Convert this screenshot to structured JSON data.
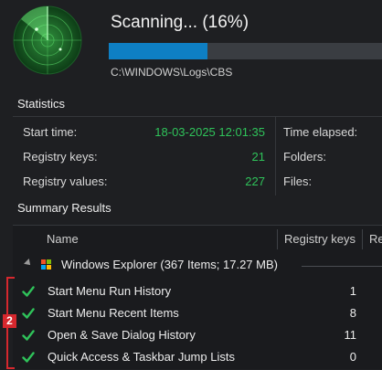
{
  "scan": {
    "title": "Scanning... (16%)",
    "progress": 0.36,
    "current_path": "C:\\WINDOWS\\Logs\\CBS"
  },
  "statistics": {
    "heading": "Statistics",
    "start_time_label": "Start time:",
    "start_time_value": "18-03-2025 12:01:35",
    "registry_keys_label": "Registry keys:",
    "registry_keys_value": "21",
    "registry_values_label": "Registry values:",
    "registry_values_value": "227",
    "time_elapsed_label": "Time elapsed:",
    "folders_label": "Folders:",
    "files_label": "Files:"
  },
  "summary": {
    "heading": "Summary Results",
    "columns": [
      "Name",
      "Registry keys",
      "Re"
    ],
    "group": {
      "label": "Windows Explorer (367 Items; 17.27 MB)",
      "icon": "windows-logo-icon"
    },
    "rows": [
      {
        "name": "Start Menu Run History",
        "registry_keys": "1"
      },
      {
        "name": "Start Menu Recent Items",
        "registry_keys": "8"
      },
      {
        "name": "Open & Save Dialog History",
        "registry_keys": "11"
      },
      {
        "name": "Quick Access & Taskbar Jump Lists",
        "registry_keys": "0"
      }
    ]
  },
  "annotation": {
    "badge": "2"
  },
  "colors": {
    "accent": "#0e7fc4",
    "success": "#2fc35a",
    "annotation_red": "#d6282e"
  }
}
